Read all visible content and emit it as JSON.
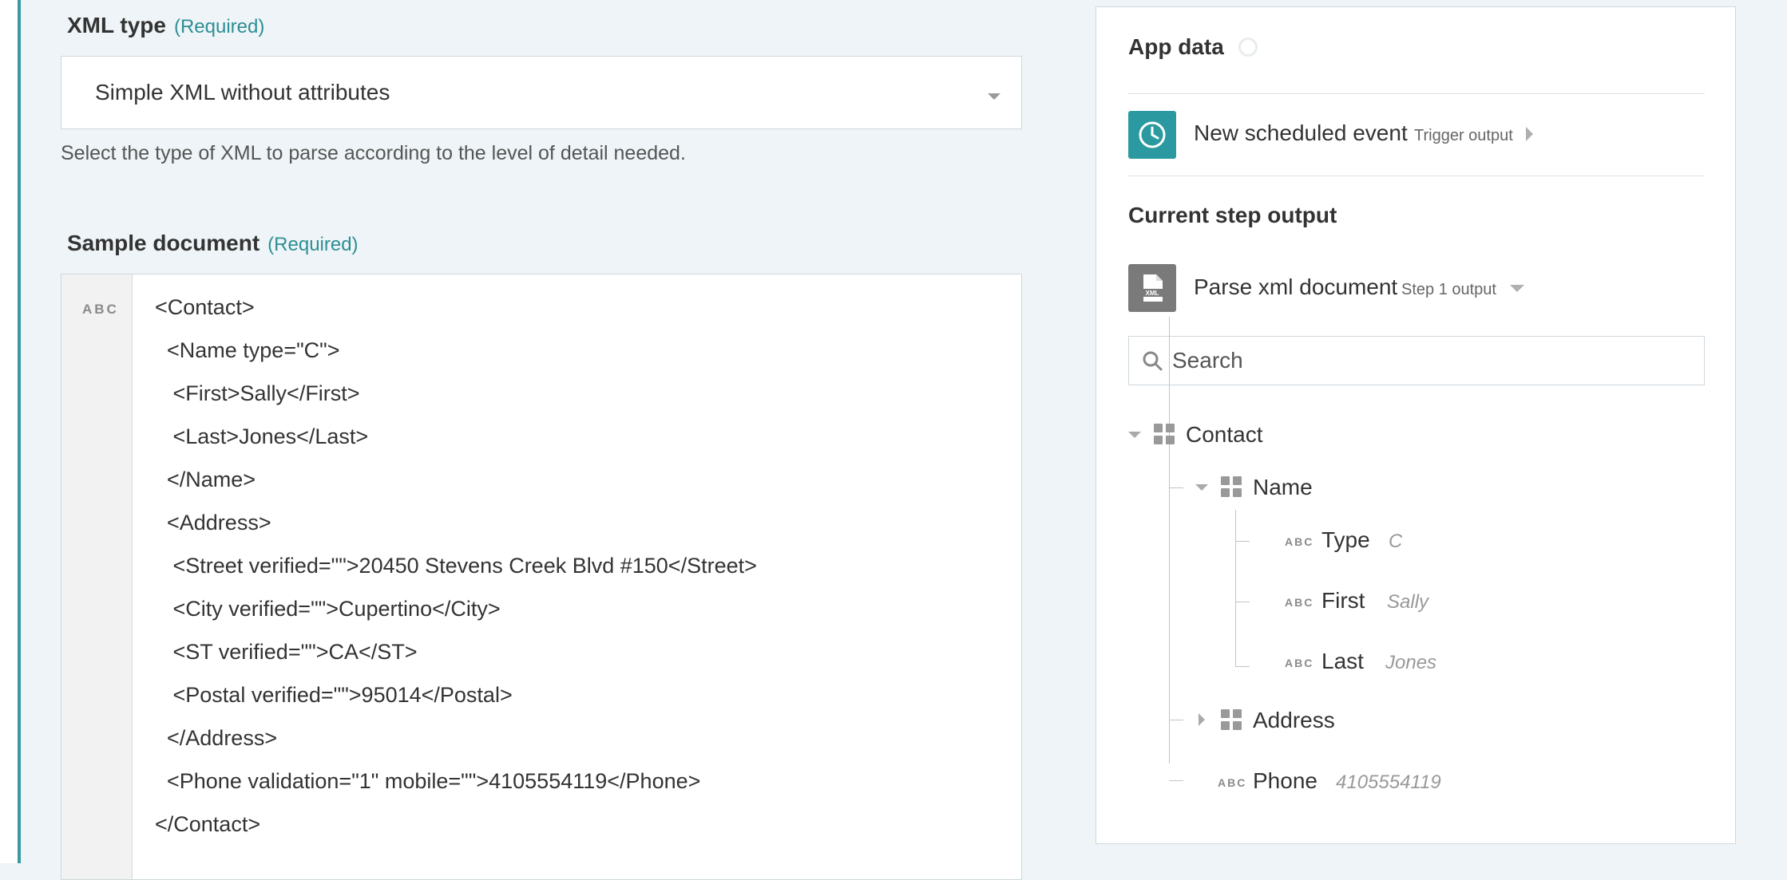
{
  "xml_type": {
    "label": "XML type",
    "required": "(Required)",
    "selected": "Simple XML without attributes",
    "help": "Select the type of XML to parse according to the level of detail needed."
  },
  "sample": {
    "label": "Sample document",
    "required": "(Required)",
    "gutter_tag": "ABC",
    "lines": [
      "<Contact>",
      "  <Name type=\"C\">",
      "   <First>Sally</First>",
      "   <Last>Jones</Last>",
      "  </Name>",
      "  <Address>",
      "   <Street verified=\"\">20450 Stevens Creek Blvd #150</Street>",
      "   <City verified=\"\">Cupertino</City>",
      "   <ST verified=\"\">CA</ST>",
      "   <Postal verified=\"\">95014</Postal>",
      "  </Address>",
      "  <Phone validation=\"1\" mobile=\"\">4105554119</Phone>",
      "</Contact>"
    ]
  },
  "panel": {
    "title": "App data",
    "trigger": {
      "title": "New scheduled event",
      "sub": "Trigger output",
      "icon": "clock-icon"
    },
    "current_title": "Current step output",
    "step": {
      "title": "Parse xml document",
      "sub": "Step 1 output",
      "icon": "xml-file-icon"
    },
    "search_placeholder": "Search",
    "tree": {
      "contact": "Contact",
      "name": "Name",
      "type": {
        "label": "Type",
        "value": "C"
      },
      "first": {
        "label": "First",
        "value": "Sally"
      },
      "last": {
        "label": "Last",
        "value": "Jones"
      },
      "address": "Address",
      "phone": {
        "label": "Phone",
        "value": "4105554119"
      },
      "abc": "ABC"
    }
  },
  "colors": {
    "accent": "#2a9aa0",
    "required": "#2d8f94"
  }
}
